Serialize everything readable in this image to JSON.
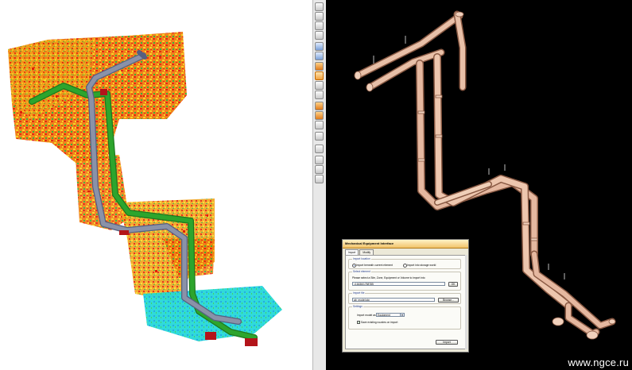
{
  "toolbar": {
    "tools": [
      {
        "icon": "select-icon"
      },
      {
        "icon": "zoom-window-icon"
      },
      {
        "icon": "zoom-in-icon"
      },
      {
        "icon": "zoom-out-icon"
      },
      {
        "icon": "walk-icon"
      },
      {
        "icon": "zoom-extents-icon"
      },
      {
        "icon": "zoom-fit-icon"
      },
      {
        "icon": "rotate-icon"
      },
      {
        "icon": "pan-icon"
      },
      {
        "icon": "axis-icon"
      },
      {
        "icon": "cube-icon"
      },
      {
        "icon": "layer-icon"
      },
      {
        "icon": "box-icon"
      },
      {
        "icon": "clip-icon"
      },
      {
        "icon": "document-icon"
      },
      {
        "icon": "measure-icon"
      },
      {
        "icon": "camera-icon"
      },
      {
        "icon": "view-icon"
      }
    ]
  },
  "dialog": {
    "title": "Mechanical Equipment Interface",
    "tabs": [
      "Import",
      "Modify"
    ],
    "import_location": {
      "label": "Import location",
      "option_current": "Import beneath current element",
      "option_storage": "Import into storage world"
    },
    "select_element": {
      "label": "Select element",
      "instruction": "Please select a Site, Zone, Equipment or Volume to import into",
      "value": "=16436/1758785",
      "ok_label": "OK"
    },
    "import_file": {
      "label": "Import file",
      "value": "ab_model.stp",
      "browse_label": "Browse..."
    },
    "settings": {
      "label": "Settings",
      "import_model_as_label": "Import model as",
      "import_model_as_value": "Equipment",
      "save_nozzles_label": "Save existing nozzles on import"
    },
    "import_button": "Import"
  },
  "watermark": "www.ngce.ru",
  "colors": {
    "pipe_green": "#2da52d",
    "pipe_gray": "#8a92a8",
    "pipe_copper": "#d9a48a",
    "scan_red": "#e0200a",
    "scan_yellow": "#f5d21a",
    "scan_cyan": "#25d8d8"
  }
}
